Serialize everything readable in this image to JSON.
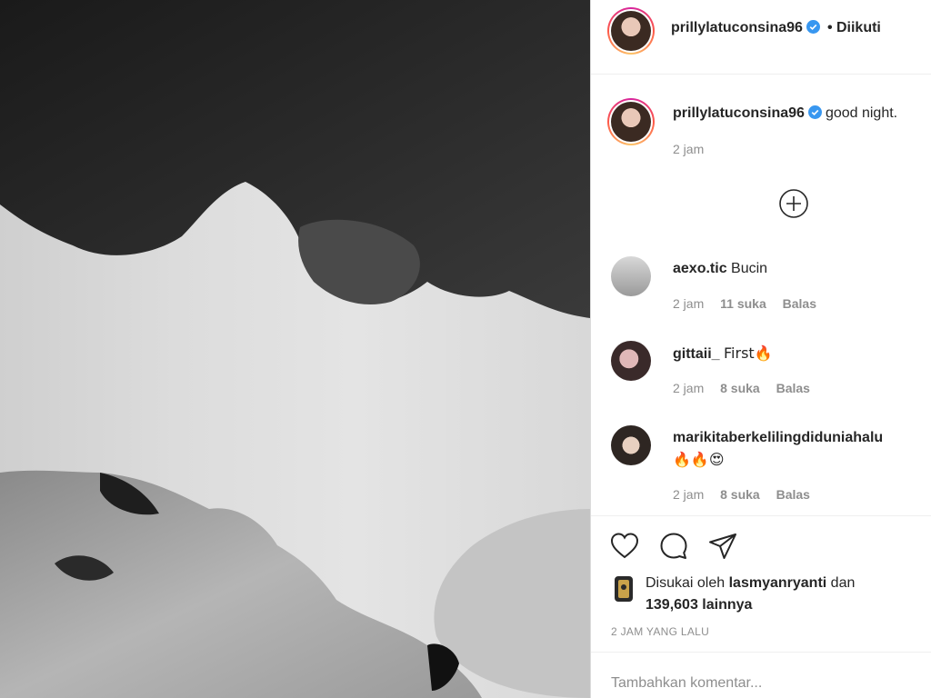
{
  "post": {
    "author": "prillylatuconsina96",
    "follow_state": "• Diikuti",
    "caption": "good night.",
    "caption_time": "2 jam"
  },
  "comments": [
    {
      "user": "aexo.tic",
      "text": "Bucin",
      "time": "2 jam",
      "likes": "11 suka",
      "reply": "Balas"
    },
    {
      "user": "gittaii_",
      "text": "First🔥",
      "time": "2 jam",
      "likes": "8 suka",
      "reply": "Balas"
    },
    {
      "user": "marikitaberkelilingdiduniahalu",
      "text": "🔥🔥😍",
      "time": "2 jam",
      "likes": "8 suka",
      "reply": "Balas"
    }
  ],
  "likes": {
    "prefix": "Disukai oleh",
    "user": "lasmyanryanti",
    "conj": "dan",
    "count": "139,603 lainnya"
  },
  "posted_ago": "2 JAM YANG LALU",
  "comment_box": {
    "placeholder": "Tambahkan komentar..."
  },
  "icons": [
    "heart-icon",
    "comment-icon",
    "share-icon",
    "plus-circle-icon",
    "verified-icon"
  ],
  "colors": {
    "verified": "#3897f0",
    "text": "#262626",
    "muted": "#8e8e8e",
    "divider": "#efefef"
  }
}
